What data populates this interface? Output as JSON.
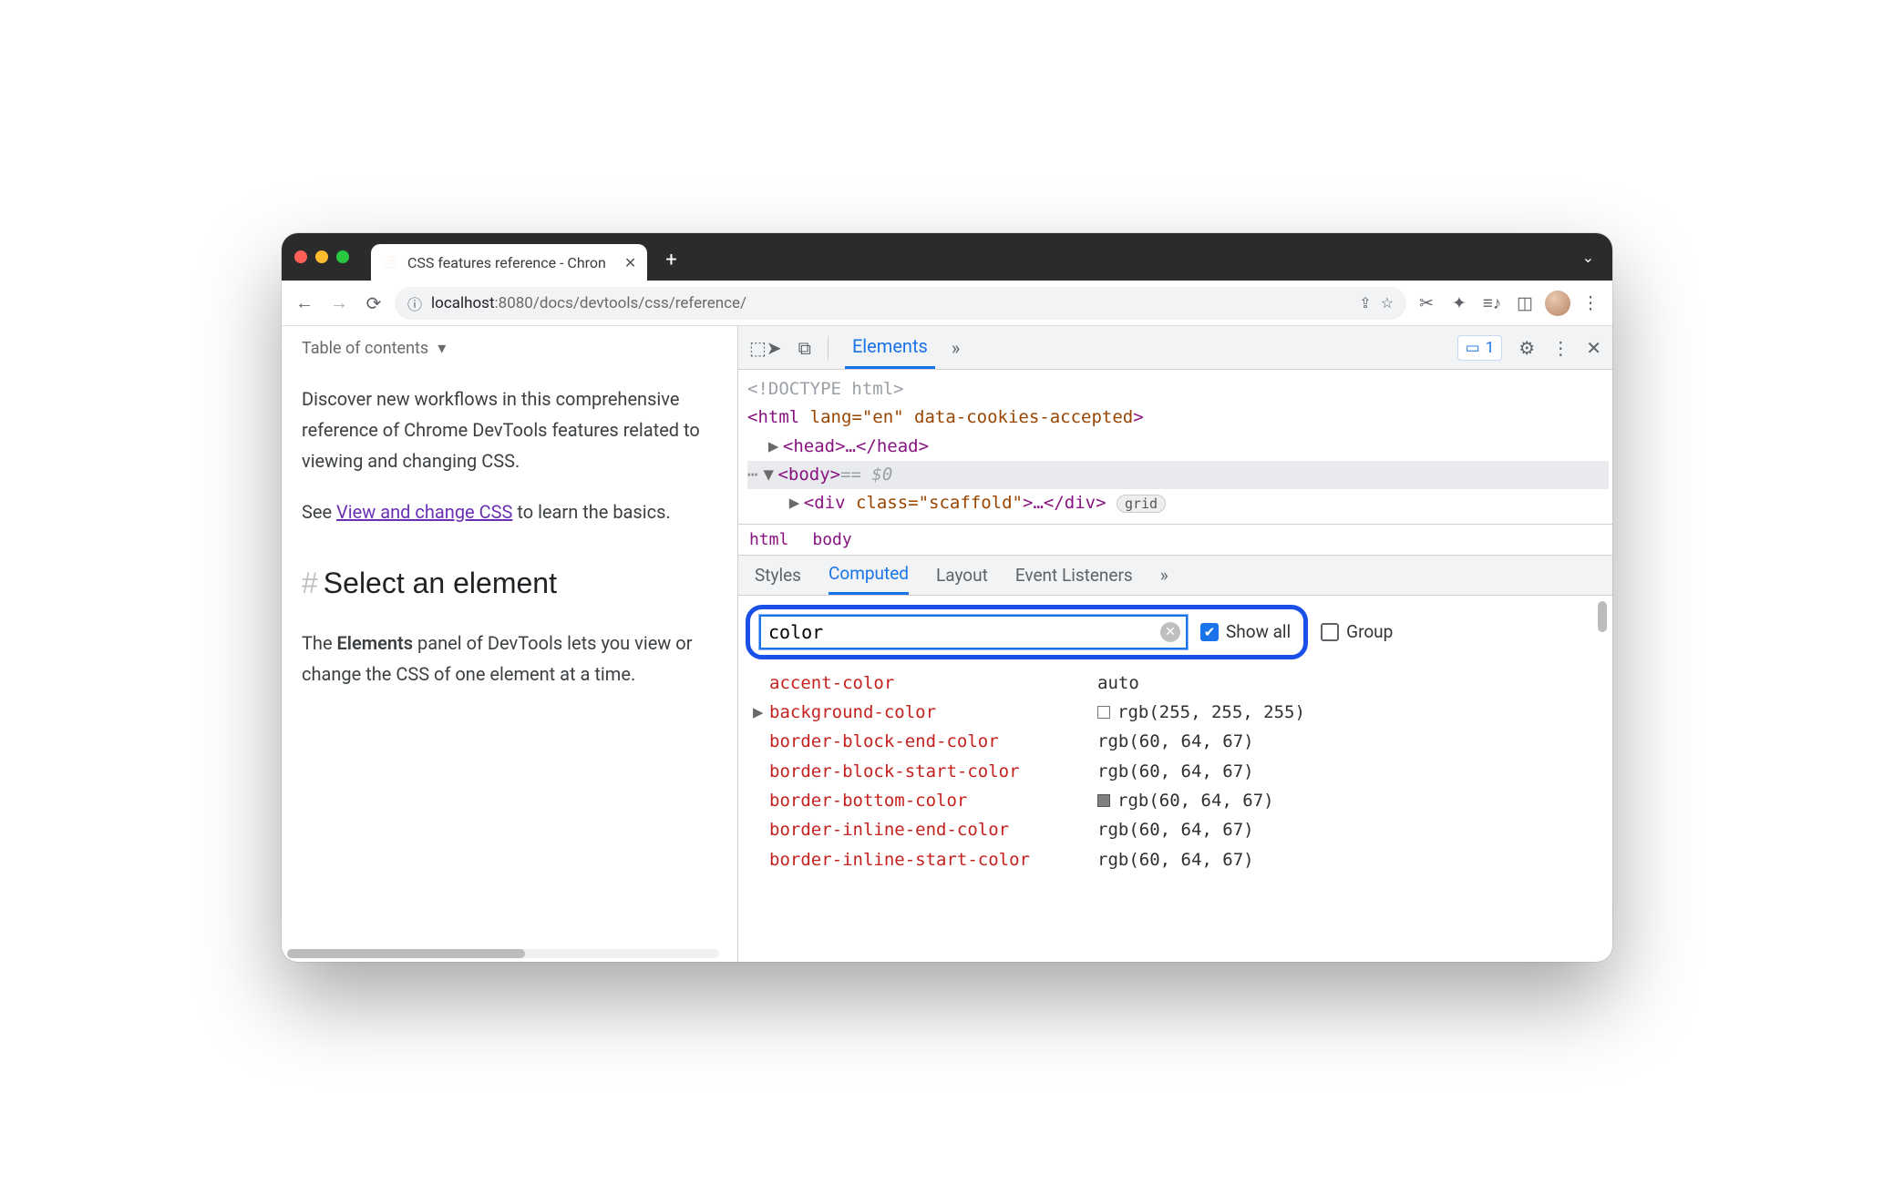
{
  "browser": {
    "tab_title": "CSS features reference - Chron",
    "url_host": "localhost",
    "url_port": ":8080",
    "url_path": "/docs/devtools/css/reference/"
  },
  "page": {
    "toc_label": "Table of contents",
    "intro": "Discover new workflows in this comprehensive reference of Chrome DevTools features related to viewing and changing CSS.",
    "see_prefix": "See ",
    "see_link": "View and change CSS",
    "see_suffix": " to learn the basics.",
    "h2": "Select an element",
    "body_prefix": "The ",
    "body_bold": "Elements",
    "body_suffix": " panel of DevTools lets you view or change the CSS of one element at a time."
  },
  "devtools": {
    "tabs": {
      "elements": "Elements"
    },
    "issues_count": "1",
    "dom": {
      "doctype": "<!DOCTYPE html>",
      "html_open": "<html ",
      "html_attr": "lang=\"en\" data-cookies-accepted",
      "html_close": ">",
      "head": "<head>…</head>",
      "body_tag": "<body>",
      "body_eq": "== $0",
      "div_open": "<div ",
      "div_attr": "class=\"scaffold\"",
      "div_rest": ">…</div>",
      "grid": "grid"
    },
    "crumbs": {
      "html": "html",
      "body": "body"
    },
    "subtabs": {
      "styles": "Styles",
      "computed": "Computed",
      "layout": "Layout",
      "listeners": "Event Listeners"
    },
    "filter": {
      "value": "color",
      "showall": "Show all",
      "group": "Group"
    },
    "props": [
      {
        "expand": false,
        "name": "accent-color",
        "value": "auto",
        "swatch": null
      },
      {
        "expand": true,
        "name": "background-color",
        "value": "rgb(255, 255, 255)",
        "swatch": "white"
      },
      {
        "expand": false,
        "name": "border-block-end-color",
        "value": "rgb(60, 64, 67)",
        "swatch": null
      },
      {
        "expand": false,
        "name": "border-block-start-color",
        "value": "rgb(60, 64, 67)",
        "swatch": null
      },
      {
        "expand": false,
        "name": "border-bottom-color",
        "value": "rgb(60, 64, 67)",
        "swatch": "grey"
      },
      {
        "expand": false,
        "name": "border-inline-end-color",
        "value": "rgb(60, 64, 67)",
        "swatch": null
      },
      {
        "expand": false,
        "name": "border-inline-start-color",
        "value": "rgb(60, 64, 67)",
        "swatch": null
      }
    ]
  }
}
